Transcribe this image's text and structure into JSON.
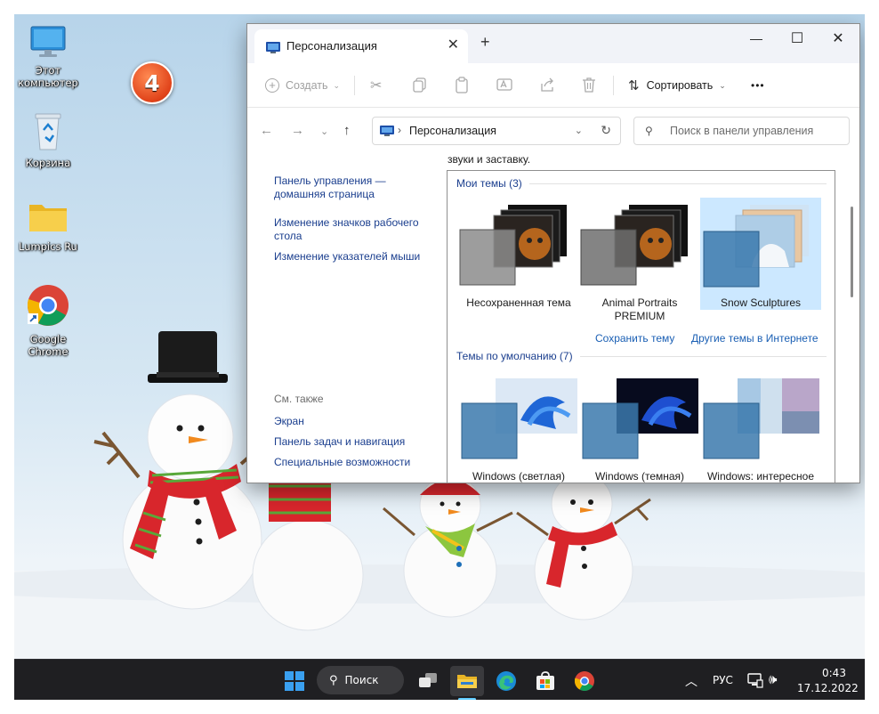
{
  "step_badge": "4",
  "desktop": {
    "icons": [
      {
        "label": "Этот компьютер"
      },
      {
        "label": "Корзина"
      },
      {
        "label": "Lumpics Ru"
      },
      {
        "label": "Google Chrome"
      }
    ]
  },
  "window": {
    "tab_title": "Персонализация",
    "new_tab": "+",
    "controls": {
      "minimize": "—",
      "maximize": "☐",
      "close": "✕"
    },
    "toolbar": {
      "create": "Создать",
      "sort": "Сортировать",
      "more": "•••"
    },
    "address": {
      "separator": "›",
      "path": "Персонализация",
      "search_placeholder": "Поиск в панели управления"
    },
    "left": {
      "home_link": "Панель управления — домашняя страница",
      "link_icons": "Изменение значков рабочего стола",
      "link_pointers": "Изменение указателей мыши",
      "see_also": "См. также",
      "see_display": "Экран",
      "see_taskbar": "Панель задач и навигация",
      "see_access": "Специальные возможности"
    },
    "content": {
      "intro": "звуки и заставку.",
      "my_themes": "Мои темы (3)",
      "themes": [
        {
          "name": "Несохраненная тема"
        },
        {
          "name": "Animal Portraits PREMIUM"
        },
        {
          "name": "Snow Sculptures"
        }
      ],
      "save_theme": "Сохранить тему",
      "more_online": "Другие темы в Интернете",
      "default_themes": "Темы по умолчанию (7)",
      "defaults": [
        {
          "name": "Windows (светлая)"
        },
        {
          "name": "Windows (темная)"
        },
        {
          "name": "Windows: интересное"
        }
      ]
    }
  },
  "taskbar": {
    "search": "Поиск",
    "language": "РУС",
    "time": "0:43",
    "date": "17.12.2022"
  },
  "colors": {
    "accent": "#0067c0",
    "link": "#1a3e8e",
    "taskbar": "#1f1f22",
    "selection": "#cce8ff",
    "badge": "#e0431a"
  }
}
